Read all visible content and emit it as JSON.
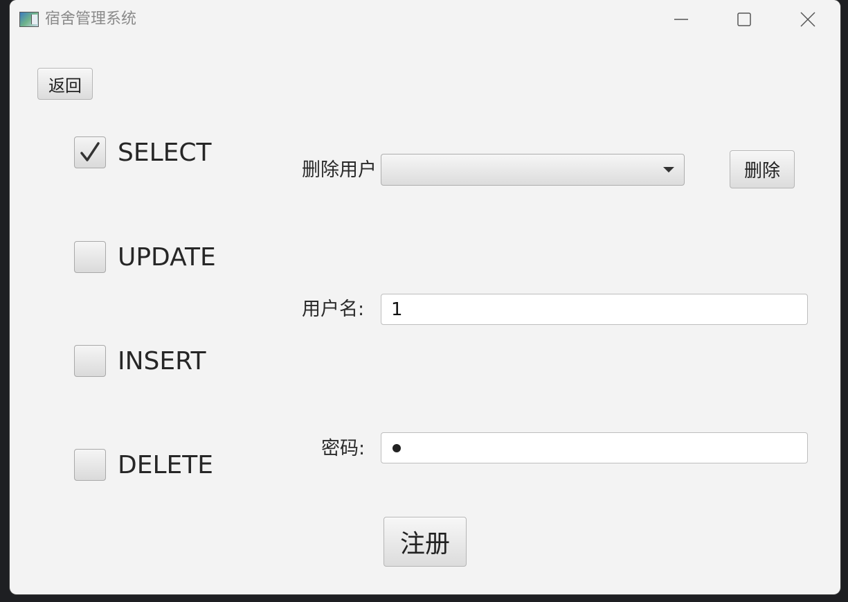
{
  "window": {
    "title": "宿舍管理系统"
  },
  "toolbar": {
    "back_label": "返回"
  },
  "permissions": [
    {
      "label": "SELECT",
      "checked": true
    },
    {
      "label": "UPDATE",
      "checked": false
    },
    {
      "label": "INSERT",
      "checked": false
    },
    {
      "label": "DELETE",
      "checked": false
    }
  ],
  "delete_user": {
    "label": "删除用户",
    "selected_value": "",
    "button_label": "删除"
  },
  "username": {
    "label": "用户名:",
    "value": "1"
  },
  "password": {
    "label": "密码:",
    "masked_length": 1
  },
  "register": {
    "button_label": "注册"
  }
}
